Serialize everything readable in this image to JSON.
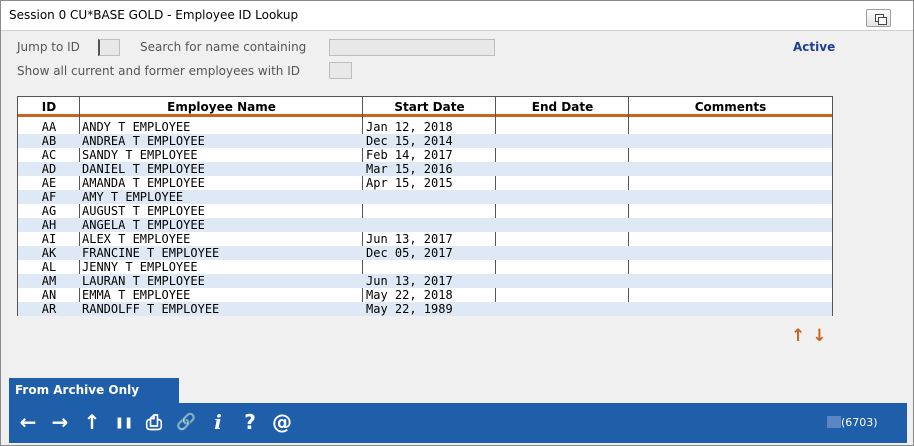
{
  "window": {
    "title": "Session 0 CU*BASE GOLD - Employee ID Lookup"
  },
  "form": {
    "jump_label": "Jump to ID",
    "search_label": "Search for name containing",
    "show_all_label": "Show all current and former employees with ID",
    "status": "Active",
    "jump_value": "",
    "search_value": "",
    "show_all_value": ""
  },
  "table": {
    "headers": [
      "ID",
      "Employee Name",
      "Start Date",
      "End Date",
      "Comments"
    ],
    "rows": [
      {
        "id": "AA",
        "name": "ANDY T EMPLOYEE",
        "start": "Jan 12, 2018",
        "end": "",
        "comments": ""
      },
      {
        "id": "AB",
        "name": "ANDREA T EMPLOYEE",
        "start": "Dec 15, 2014",
        "end": "",
        "comments": ""
      },
      {
        "id": "AC",
        "name": "SANDY T EMPLOYEE",
        "start": "Feb 14, 2017",
        "end": "",
        "comments": ""
      },
      {
        "id": "AD",
        "name": "DANIEL T EMPLOYEE",
        "start": "Mar 15, 2016",
        "end": "",
        "comments": ""
      },
      {
        "id": "AE",
        "name": "AMANDA T EMPLOYEE",
        "start": "Apr 15, 2015",
        "end": "",
        "comments": ""
      },
      {
        "id": "AF",
        "name": "AMY T EMPLOYEE",
        "start": "",
        "end": "",
        "comments": ""
      },
      {
        "id": "AG",
        "name": "AUGUST T EMPLOYEE",
        "start": "",
        "end": "",
        "comments": ""
      },
      {
        "id": "AH",
        "name": "ANGELA T EMPLOYEE",
        "start": "",
        "end": "",
        "comments": ""
      },
      {
        "id": "AI",
        "name": "ALEX T EMPLOYEE",
        "start": "Jun 13, 2017",
        "end": "",
        "comments": ""
      },
      {
        "id": "AK",
        "name": "FRANCINE T EMPLOYEE",
        "start": "Dec 05, 2017",
        "end": "",
        "comments": ""
      },
      {
        "id": "AL",
        "name": "JENNY T EMPLOYEE",
        "start": "",
        "end": "",
        "comments": ""
      },
      {
        "id": "AM",
        "name": "LAURAN T EMPLOYEE",
        "start": "Jun 13, 2017",
        "end": "",
        "comments": ""
      },
      {
        "id": "AN",
        "name": "EMMA T EMPLOYEE",
        "start": "May 22, 2018",
        "end": "",
        "comments": ""
      },
      {
        "id": "AR",
        "name": "RANDOLFF T EMPLOYEE",
        "start": "May 22, 1989",
        "end": "",
        "comments": ""
      }
    ]
  },
  "scroll": {
    "up_icon": "↑",
    "down_icon": "↓"
  },
  "footer": {
    "archive_label": "From Archive Only",
    "toolbar": {
      "back": "←",
      "forward": "→",
      "up": "↑",
      "pause": "❚❚",
      "print": "⎙",
      "link": "🔗",
      "info": "i",
      "help": "?",
      "email": "@"
    },
    "screen_code": "(6703)"
  },
  "colors": {
    "accent": "#c8641c",
    "bar": "#1f5ea8",
    "status": "#1f3f8f",
    "alt_row": "#dfe9f5"
  }
}
